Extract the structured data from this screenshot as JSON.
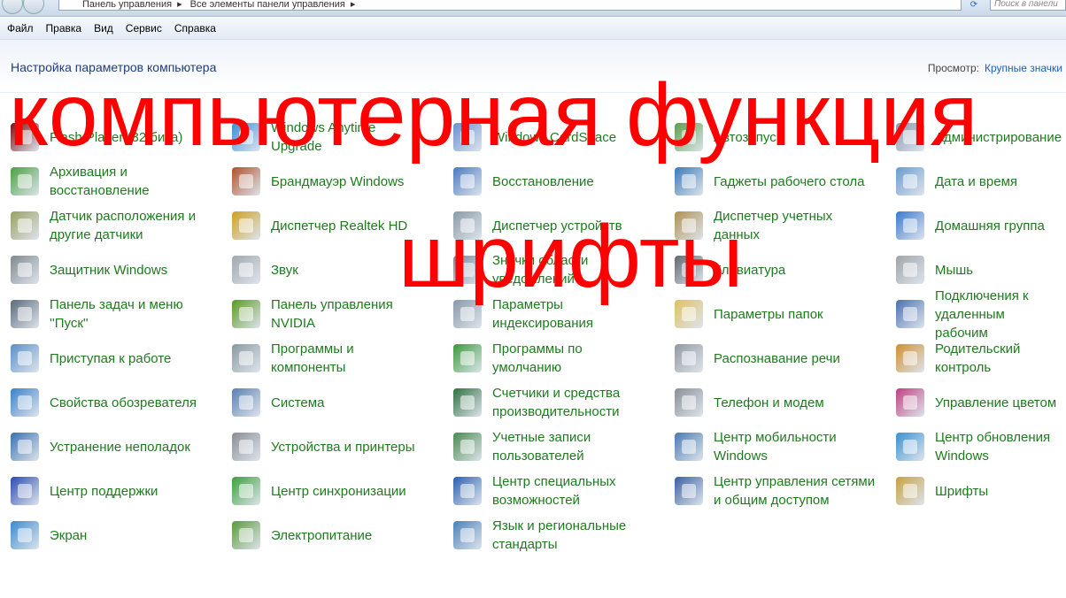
{
  "address_bar": {
    "breadcrumbs": [
      "Панель управления",
      "Все элементы панели управления"
    ],
    "search_placeholder": "Поиск в панели"
  },
  "menu": [
    "Файл",
    "Правка",
    "Вид",
    "Сервис",
    "Справка"
  ],
  "header": {
    "title": "Настройка параметров компьютера",
    "view_label": "Просмотр:",
    "view_value": "Крупные значки"
  },
  "overlay": {
    "line1": "компьютерная функция",
    "line2": "шрифты"
  },
  "items": [
    {
      "label": "Flash Player (32 бита)",
      "icon": "flash-icon",
      "color": "#7a1010"
    },
    {
      "label": "Windows Anytime\nUpgrade",
      "icon": "windows-upgrade-icon",
      "color": "#3a8fd8"
    },
    {
      "label": "Windows CardSpace",
      "icon": "cardspace-icon",
      "color": "#6a8fd0"
    },
    {
      "label": "Автозапуск",
      "icon": "autoplay-icon",
      "color": "#5aa04a"
    },
    {
      "label": "Администрирование",
      "icon": "admin-tools-icon",
      "color": "#8a9ab0"
    },
    {
      "label": "Архивация и\nвосстановление",
      "icon": "backup-icon",
      "color": "#4aa040"
    },
    {
      "label": "Брандмауэр Windows",
      "icon": "firewall-icon",
      "color": "#b0502a"
    },
    {
      "label": "Восстановление",
      "icon": "recovery-icon",
      "color": "#4a7ac0"
    },
    {
      "label": "Гаджеты рабочего стола",
      "icon": "gadgets-icon",
      "color": "#3a7ab8"
    },
    {
      "label": "Дата и время",
      "icon": "clock-icon",
      "color": "#6a9ad0"
    },
    {
      "label": "Датчик расположения и\nдругие датчики",
      "icon": "sensor-icon",
      "color": "#9aa060"
    },
    {
      "label": "Диспетчер Realtek HD",
      "icon": "realtek-icon",
      "color": "#d0a020"
    },
    {
      "label": "Диспетчер устройств",
      "icon": "device-manager-icon",
      "color": "#8a9aa8"
    },
    {
      "label": "Диспетчер учетных\nданных",
      "icon": "credential-icon",
      "color": "#b09050"
    },
    {
      "label": "Домашняя группа",
      "icon": "homegroup-icon",
      "color": "#3a7ad0"
    },
    {
      "label": "Защитник Windows",
      "icon": "defender-icon",
      "color": "#808890"
    },
    {
      "label": "Звук",
      "icon": "speaker-icon",
      "color": "#a0a8b0"
    },
    {
      "label": "Значки области\nуведомлений",
      "icon": "notification-icon",
      "color": "#7a8a9a"
    },
    {
      "label": "Клавиатура",
      "icon": "keyboard-icon",
      "color": "#606870"
    },
    {
      "label": "Мышь",
      "icon": "mouse-icon",
      "color": "#a0a4a8"
    },
    {
      "label": "Панель задач и меню\n''Пуск''",
      "icon": "taskbar-icon",
      "color": "#5a6a7a"
    },
    {
      "label": "Панель управления\nNVIDIA",
      "icon": "nvidia-icon",
      "color": "#5a9a20"
    },
    {
      "label": "Параметры\nиндексирования",
      "icon": "indexing-icon",
      "color": "#8a98a8"
    },
    {
      "label": "Параметры папок",
      "icon": "folder-icon",
      "color": "#e0c060"
    },
    {
      "label": "Подключения к\nудаленным рабочим",
      "icon": "remote-icon",
      "color": "#4a70b0"
    },
    {
      "label": "Приступая к работе",
      "icon": "getting-started-icon",
      "color": "#5a90c8"
    },
    {
      "label": "Программы и\nкомпоненты",
      "icon": "programs-icon",
      "color": "#8a9aa0"
    },
    {
      "label": "Программы по\nумолчанию",
      "icon": "default-programs-icon",
      "color": "#3a9a3a"
    },
    {
      "label": "Распознавание речи",
      "icon": "microphone-icon",
      "color": "#9098a0"
    },
    {
      "label": "Родительский контроль",
      "icon": "parental-icon",
      "color": "#d09030"
    },
    {
      "label": "Свойства обозревателя",
      "icon": "internet-options-icon",
      "color": "#3a80c8"
    },
    {
      "label": "Система",
      "icon": "system-icon",
      "color": "#5a80b0"
    },
    {
      "label": "Счетчики и средства\nпроизводительности",
      "icon": "performance-icon",
      "color": "#307040"
    },
    {
      "label": "Телефон и модем",
      "icon": "phone-icon",
      "color": "#8a9098"
    },
    {
      "label": "Управление цветом",
      "icon": "color-management-icon",
      "color": "#c04080"
    },
    {
      "label": "Устранение неполадок",
      "icon": "troubleshoot-icon",
      "color": "#3a70b0"
    },
    {
      "label": "Устройства и принтеры",
      "icon": "printer-icon",
      "color": "#8a8e94"
    },
    {
      "label": "Учетные записи\nпользователей",
      "icon": "users-icon",
      "color": "#4a8a50"
    },
    {
      "label": "Центр мобильности\nWindows",
      "icon": "mobility-icon",
      "color": "#4a7ab0"
    },
    {
      "label": "Центр обновления\nWindows",
      "icon": "windows-update-icon",
      "color": "#3a90d0"
    },
    {
      "label": "Центр поддержки",
      "icon": "action-center-icon",
      "color": "#2a4ab0"
    },
    {
      "label": "Центр синхронизации",
      "icon": "sync-icon",
      "color": "#3aa03a"
    },
    {
      "label": "Центр специальных\nвозможностей",
      "icon": "accessibility-icon",
      "color": "#2a60b0"
    },
    {
      "label": "Центр управления сетями\nи общим доступом",
      "icon": "network-icon",
      "color": "#3a60a0"
    },
    {
      "label": "Шрифты",
      "icon": "fonts-icon",
      "color": "#c8a040"
    },
    {
      "label": "Экран",
      "icon": "display-icon",
      "color": "#3a8ad0"
    },
    {
      "label": "Электропитание",
      "icon": "power-icon",
      "color": "#5a9a3a"
    },
    {
      "label": "Язык и региональные\nстандарты",
      "icon": "region-icon",
      "color": "#4a80b8"
    }
  ]
}
